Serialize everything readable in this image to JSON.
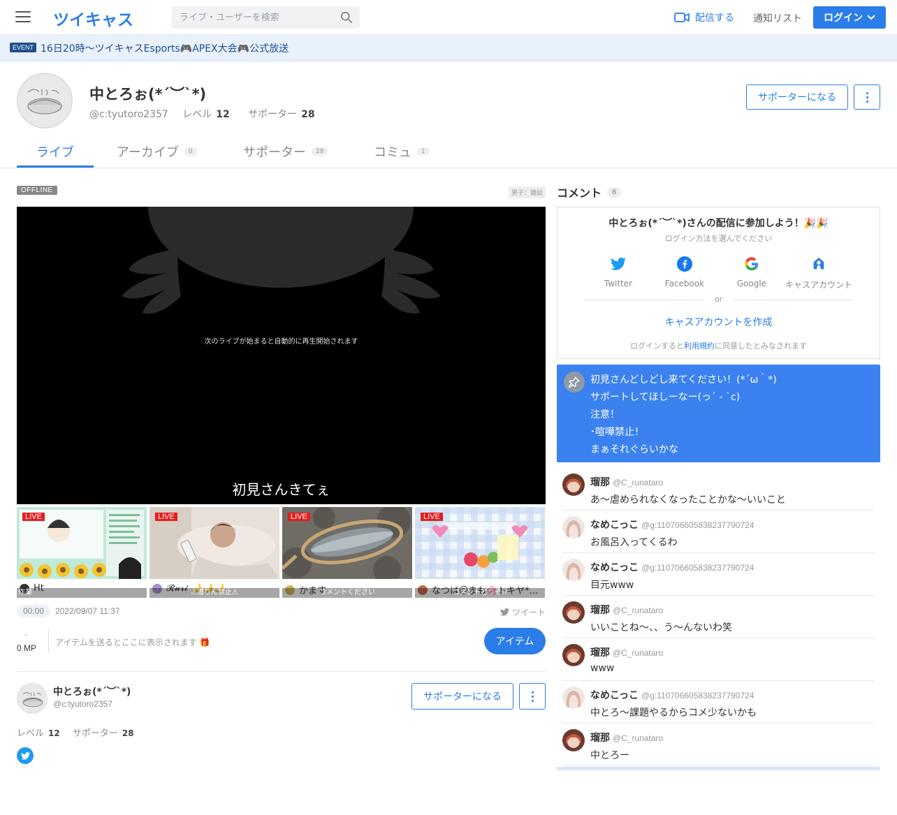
{
  "header": {
    "logo": "ツイキャス",
    "search_placeholder": "ライブ・ユーザーを検索",
    "broadcast_label": "配信する",
    "notify_label": "通知リスト",
    "login_label": "ログイン"
  },
  "event": {
    "tag": "EVENT",
    "text": "16日20時〜ツイキャスEsports🎮APEX大会🎮公式放送"
  },
  "profile": {
    "name": "中とろぉ(*´︶`*)",
    "user_id": "@c:tyutoro2357",
    "level_label": "レベル",
    "level": "12",
    "supporter_label": "サポーター",
    "supporter_count": "28",
    "support_button": "サポーターになる"
  },
  "tabs": [
    {
      "label": "ライブ",
      "count": ""
    },
    {
      "label": "アーカイブ",
      "count": "0"
    },
    {
      "label": "サポーター",
      "count": "28"
    },
    {
      "label": "コミュ",
      "count": "1"
    }
  ],
  "live": {
    "status": "OFFLINE",
    "genre": "男子：雑談",
    "player_message": "次のライブが始まると自動的に再生開始されます",
    "player_title": "初見さんきてぇ",
    "timer": "00:00",
    "date": "2022/09/07 11:37",
    "tweet_label": "ツイート",
    "mp_dash": "-",
    "mp": "0 MP",
    "item_message": "アイテムを送るとここに表示されます 🎁",
    "item_button": "アイテム"
  },
  "recommendations": [
    {
      "badge": "LIVE",
      "caption": "作業",
      "owner": "Ht"
    },
    {
      "badge": "LIVE",
      "caption": "⚠潜りん禁止⚠",
      "owner": "𝓡𝓾𝓻𝓲 🌙🌙🌙"
    },
    {
      "badge": "LIVE",
      "caption": "コメントください",
      "owner": "かます"
    },
    {
      "badge": "LIVE",
      "caption": "コメントどうぞ!!",
      "owner": "なつは＠まも🌸トキヤ*..."
    }
  ],
  "owner_card": {
    "name": "中とろぉ(*´︶`*)",
    "user_id": "@c:tyutoro2357",
    "level_label": "レベル",
    "level": "12",
    "supporter_label": "サポーター",
    "supporter_count": "28",
    "support_button": "サポーターになる"
  },
  "comments_panel": {
    "title": "コメント",
    "count": "8",
    "login_title": "中とろぉ(*´︶`*)さんの配信に参加しよう！🎉🎉",
    "login_sub": "ログイン方法を選んでください",
    "sso": [
      {
        "label": "Twitter",
        "icon": "twitter-icon"
      },
      {
        "label": "Facebook",
        "icon": "facebook-icon"
      },
      {
        "label": "Google",
        "icon": "google-icon"
      },
      {
        "label": "キャスアカウント",
        "icon": "cas-account-icon"
      }
    ],
    "or": "or",
    "create_account": "キャスアカウントを作成",
    "terms_prefix": "ログインすると",
    "terms_link": "利用規約",
    "terms_suffix": "に同意したとみなされます",
    "pinned": [
      "初見さんどしどし来てください！(*´ω｀*)",
      "サポートしてほしーなー(っ´ - `c)",
      "注意！",
      "･喧嘩禁止！",
      "まぁそれぐらいかな"
    ],
    "comments": [
      {
        "name": "瑠那",
        "id": "@C_runataro",
        "text": "あ〜虐められなくなったことかな〜いいこと"
      },
      {
        "name": "なめこっこ",
        "id": "@g:110706605838237790724",
        "text": "お風呂入ってくるわ"
      },
      {
        "name": "なめこっこ",
        "id": "@g:110706605838237790724",
        "text": "目元www"
      },
      {
        "name": "瑠那",
        "id": "@C_runataro",
        "text": "いいことね〜、、う〜んないわ笑"
      },
      {
        "name": "瑠那",
        "id": "@C_runataro",
        "text": "www"
      },
      {
        "name": "なめこっこ",
        "id": "@g:110706605838237790724",
        "text": "中とろ〜課題やるからコメ少ないかも"
      },
      {
        "name": "瑠那",
        "id": "@C_runataro",
        "text": "中とろー"
      }
    ]
  },
  "colors": {
    "accent": "#2b7de9",
    "pinned_bg": "#3b82f0",
    "live_badge": "#e51e1e",
    "event_bg": "#e8f1fc"
  }
}
